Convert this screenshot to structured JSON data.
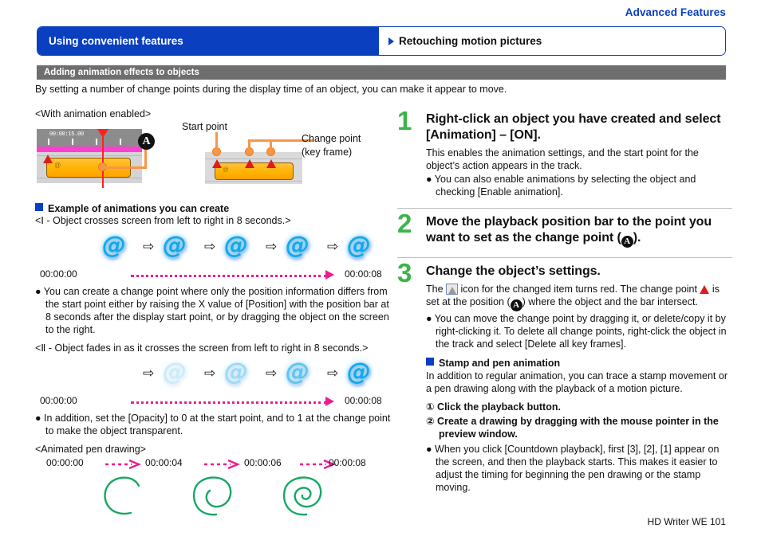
{
  "header": {
    "advanced_features": "Advanced Features",
    "tab_left": "Using convenient features",
    "tab_right": "Retouching motion pictures",
    "section_title": "Adding animation effects to objects",
    "intro": "By setting a number of change points during the display time of an object, you can make it appear to move."
  },
  "left": {
    "diagram_caption": "<With animation enabled>",
    "timecode": "00:00:15.00",
    "badge_a": "A",
    "start_point_label": "Start point",
    "change_point_label_1": "Change point",
    "change_point_label_2": "(key frame)",
    "example_heading": "Example of animations you can create",
    "example1_caption": "<Ⅰ - Object crosses screen from left to right in 8 seconds.>",
    "anim1": {
      "time_start": "00:00:00",
      "time_end": "00:00:08",
      "symbols": [
        "@",
        "@",
        "@",
        "@",
        "@"
      ],
      "arrow": "⇨"
    },
    "example1_note": "● You can create a change point where only the position information differs from the start point either by raising the X value of [Position] with the position bar at 8 seconds after the display start point, or by dragging the object on the screen to the right.",
    "example2_caption": "<Ⅱ - Object fades in as it crosses the screen from left to right in 8 seconds.>",
    "anim2": {
      "time_start": "00:00:00",
      "time_end": "00:00:08",
      "arrow": "⇨"
    },
    "example2_note": "● In addition, set the [Opacity] to 0 at the start point, and to 1 at the change point to make the object transparent.",
    "pen_caption": "<Animated pen drawing>",
    "pen_times": [
      "00:00:00",
      "00:00:04",
      "00:00:06",
      "00:00:08"
    ]
  },
  "right": {
    "steps": [
      {
        "num": "1",
        "title": "Right-click an object you have created and select [Animation] – [ON].",
        "body": "This enables the animation settings, and the start point for the object’s action appears in the track.",
        "bullet": "● You can also enable animations by selecting the object and checking [Enable animation]."
      },
      {
        "num": "2",
        "title_pre": "Move the playback position bar to the point you want to set as the change point (",
        "title_badge": "A",
        "title_post": ")."
      },
      {
        "num": "3",
        "title": "Change the object’s settings.",
        "body_pre": "The ",
        "body_mid": " icon for the changed item turns red. The change point ",
        "body_post_a": " is set at the position (",
        "body_badge": "A",
        "body_post_b": ") where the object and the bar intersect.",
        "bullet": "● You can move the change point by dragging it, or delete/copy it by right-clicking it. To delete all change points, right-click the object in the track and select [Delete all key frames]."
      }
    ],
    "stamp_heading": "Stamp and pen animation",
    "stamp_body": "In addition to regular animation, you can trace a stamp movement or a pen drawing along with the playback of a motion picture.",
    "num_item_1": "① Click the playback button.",
    "num_item_2": "② Create a drawing by dragging with the mouse pointer in the preview window.",
    "final_bullet": "● When you click [Countdown playback], first [3], [2], [1] appear on the screen, and then the playback starts. This makes it easier to adjust the timing for beginning the pen drawing or the stamp moving."
  },
  "footer": {
    "text": "HD Writer WE   101"
  },
  "colors": {
    "brand_blue": "#0a3fbf",
    "section_gray": "#6e6e6e",
    "step_green": "#3cb44a",
    "magenta": "#ec1c8e",
    "orange": "#f79646",
    "clip_orange": "#ffb300",
    "red": "#e01b1b",
    "pen_green": "#16a765",
    "at_cyan": "#12a9e8"
  }
}
